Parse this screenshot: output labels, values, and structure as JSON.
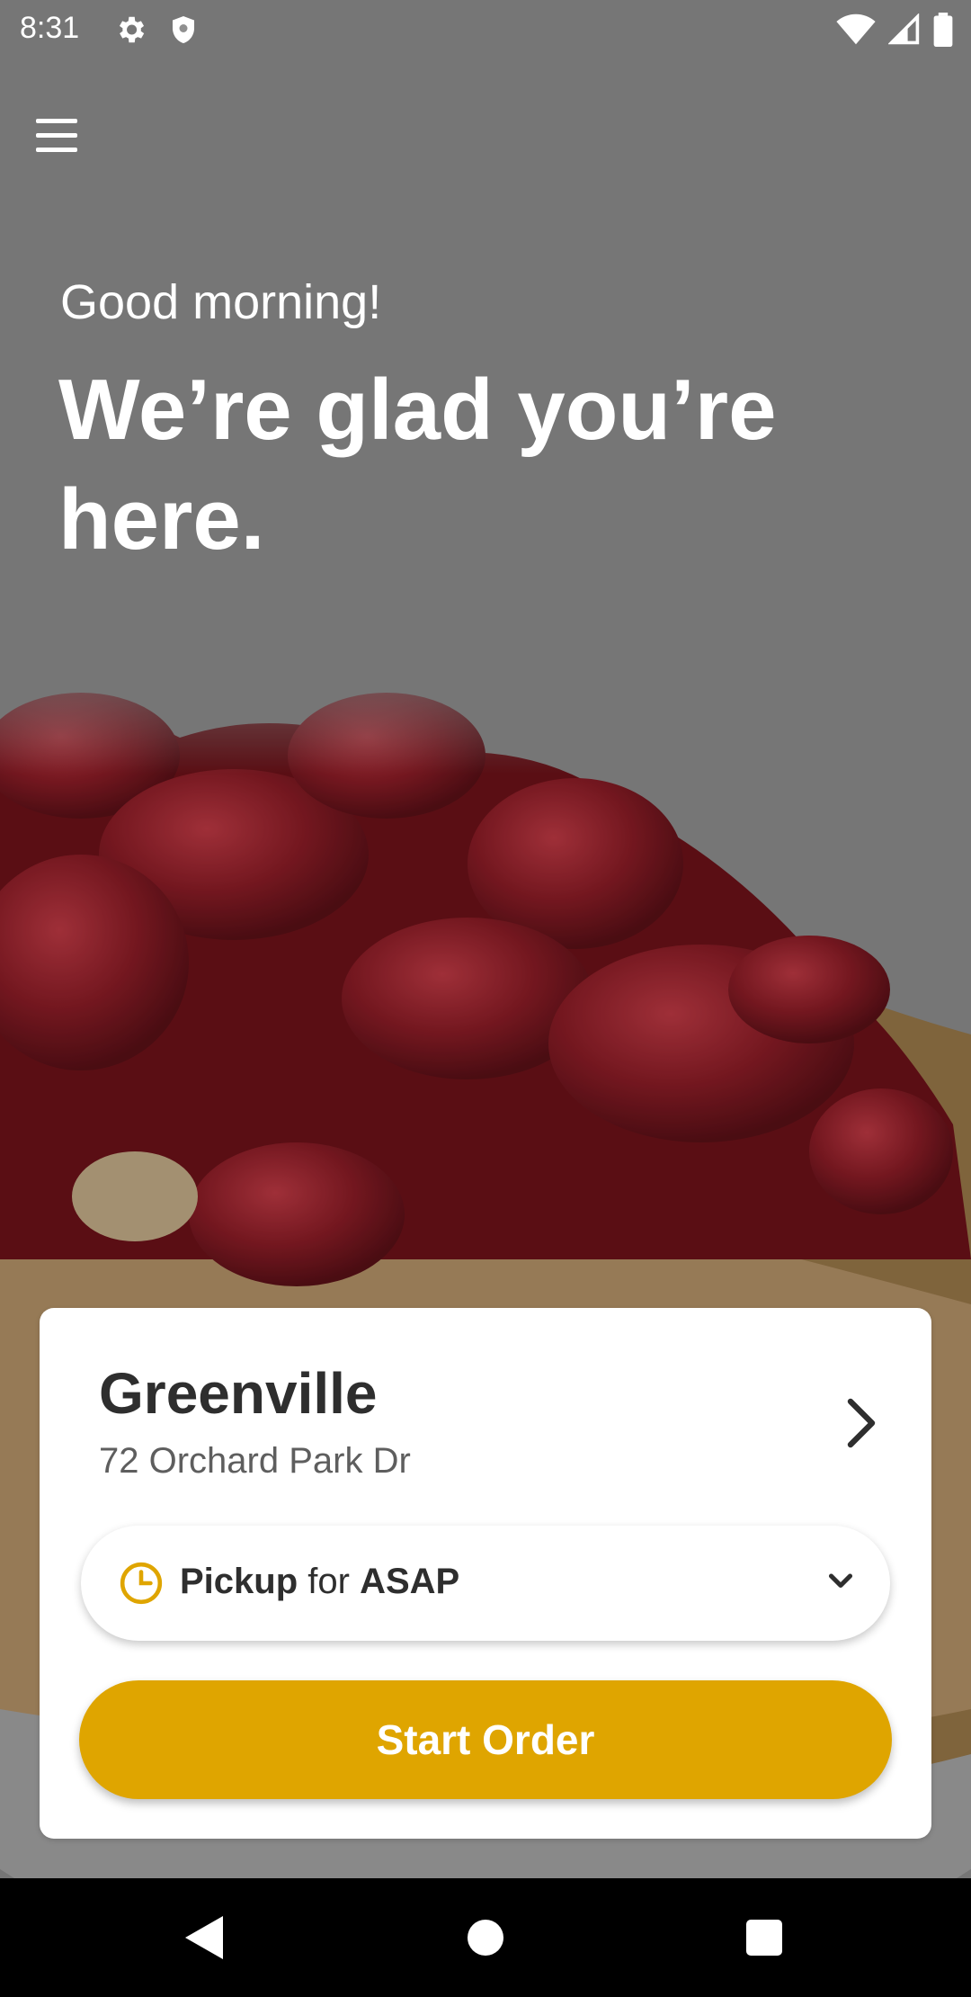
{
  "status_bar": {
    "time": "8:31",
    "left_icons": [
      "gear-icon",
      "shield-icon"
    ],
    "right_icons": [
      "wifi-icon",
      "signal-icon",
      "battery-icon"
    ]
  },
  "header": {
    "menu_icon": "hamburger-menu-icon",
    "greeting": "Good morning!",
    "headline": "We’re glad you’re here."
  },
  "location_card": {
    "store_name": "Greenville",
    "store_address": "72 Orchard Park Dr",
    "pickup": {
      "mode": "Pickup",
      "connector": "for",
      "time": "ASAP"
    },
    "start_button": "Start Order"
  },
  "colors": {
    "accent": "#dfa500",
    "clock_icon": "#dfa500",
    "card_bg": "#ffffff",
    "overlay": "#8f8f8f"
  },
  "nav_bar": {
    "icons": [
      "back-icon",
      "home-icon",
      "recents-icon"
    ]
  }
}
